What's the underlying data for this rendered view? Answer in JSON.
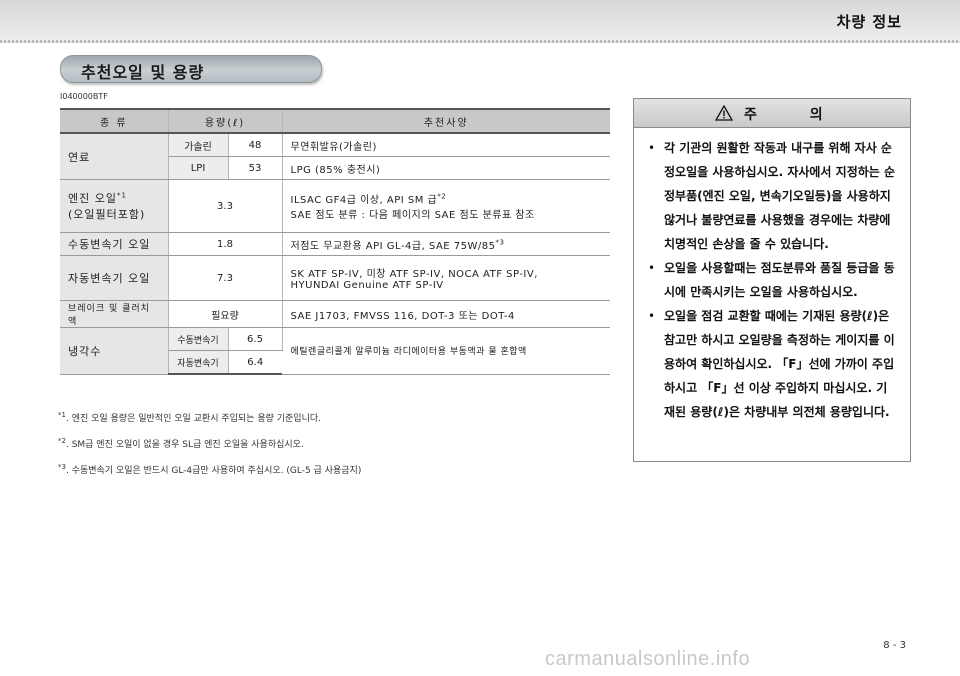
{
  "header": {
    "title": "차량 정보"
  },
  "section": {
    "title": "추천오일 및 용량",
    "code": "I040000BTF"
  },
  "table": {
    "headers": [
      "종 류",
      "용량(ℓ)",
      "추천사양"
    ],
    "rows": {
      "fuel": {
        "name": "연료",
        "gasoline": {
          "label": "가솔린",
          "value": "48",
          "spec": "무연휘발유(가솔린)"
        },
        "lpi": {
          "label": "LPI",
          "value": "53",
          "spec": "LPG (85% 충전시)"
        }
      },
      "engine_oil": {
        "name_line1": "엔진 오일",
        "name_mark": "*1",
        "name_line2": "(오일필터포함)",
        "value": "3.3",
        "spec_line1": "ILSAC GF4급 이상, API SM 급",
        "spec_mark": "*2",
        "spec_line2": "SAE 점도 분류 : 다음 페이지의 SAE 점도 분류표 참조"
      },
      "manual_trans": {
        "name": "수동변속기 오일",
        "value": "1.8",
        "spec": "저점도 무교환용 API GL-4급, SAE 75W/85",
        "spec_mark": "*3"
      },
      "auto_trans": {
        "name": "자동변속기 오일",
        "value": "7.3",
        "spec_line1": "SK ATF SP-IV, 미창 ATF SP-IV, NOCA ATF SP-IV,",
        "spec_line2": "HYUNDAI Genuine ATF SP-IV"
      },
      "brake": {
        "name": "브레이크 및 클러치 액",
        "value": "필요량",
        "spec": "SAE J1703, FMVSS 116, DOT-3 또는 DOT-4"
      },
      "coolant": {
        "name": "냉각수",
        "manual": {
          "label": "수동변속기",
          "value": "6.5"
        },
        "auto": {
          "label": "자동변속기",
          "value": "6.4"
        },
        "spec": "에틸렌글리콜계 알루미늄 라디에이터용 부동액과 물 혼합액"
      }
    }
  },
  "footnotes": [
    {
      "mark": "*1",
      "text": ". 엔진 오일 용량은 일반적인 오일 교환시 주입되는 용량 기준입니다."
    },
    {
      "mark": "*2",
      "text": ". SM급 엔진 오일이 없을 경우 SL급 엔진 오일을 사용하십시오."
    },
    {
      "mark": "*3",
      "text": ". 수동변속기 오일은 반드시 GL-4급만 사용하여 주십시오. (GL-5 급 사용금지)"
    }
  ],
  "caution": {
    "title": "주 의",
    "icon": "warning-triangle-icon",
    "items": [
      "각 기관의 원활한 작동과 내구를 위해 자사 순정오일을 사용하십시오. 자사에서 지정하는 순정부품(엔진 오일, 변속기오일등)을 사용하지 않거나 불량연료를 사용했을 경우에는 차량에 치명적인 손상을 줄 수 있습니다.",
      "오일을 사용할때는 점도분류와 품질 등급을 동시에 만족시키는 오일을 사용하십시오.",
      "오일을 점검 교환할 때에는 기재된 용량(ℓ)은 참고만 하시고 오일량을 측정하는 게이지를 이용하여 확인하십시오. 「F」선에 가까이 주입하시고 「F」선 이상 주입하지 마십시오. 기재된 용량(ℓ)은 차량내부 의전체 용량입니다."
    ]
  },
  "page_number": "8 - 3",
  "watermark": "carmanualsonline.info"
}
